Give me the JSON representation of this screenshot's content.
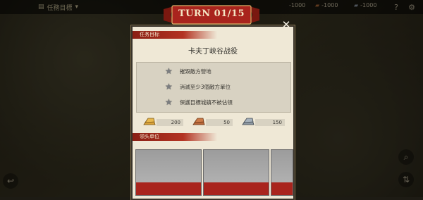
{
  "topbar": {
    "mission_tab_label": "任務目標",
    "resources": [
      {
        "name": "gold",
        "value": "-1000"
      },
      {
        "name": "wood",
        "value": "-1000"
      },
      {
        "name": "iron",
        "value": "-1000"
      }
    ]
  },
  "dialog": {
    "turn_label": "TURN 01/15",
    "objectives_header": "任务目标",
    "mission_name": "卡夫丁峡谷战役",
    "objectives": [
      {
        "text": "摧毀敵方營地",
        "icon": "star-icon"
      },
      {
        "text": "消滅至少3個敵方單位",
        "icon": "star-icon"
      },
      {
        "text": "保護目標城鎮不被佔領",
        "icon": "star-icon"
      }
    ],
    "rewards": [
      {
        "icon": "gold-ingot-icon",
        "value": "200"
      },
      {
        "icon": "copper-ingot-icon",
        "value": "50"
      },
      {
        "icon": "iron-ingot-icon",
        "value": "150"
      }
    ],
    "units_header": "领头单位"
  },
  "colors": {
    "ribbon_red": "#a9241d",
    "panel_bg": "#efe8d6",
    "header_red": "#8a1f14"
  }
}
